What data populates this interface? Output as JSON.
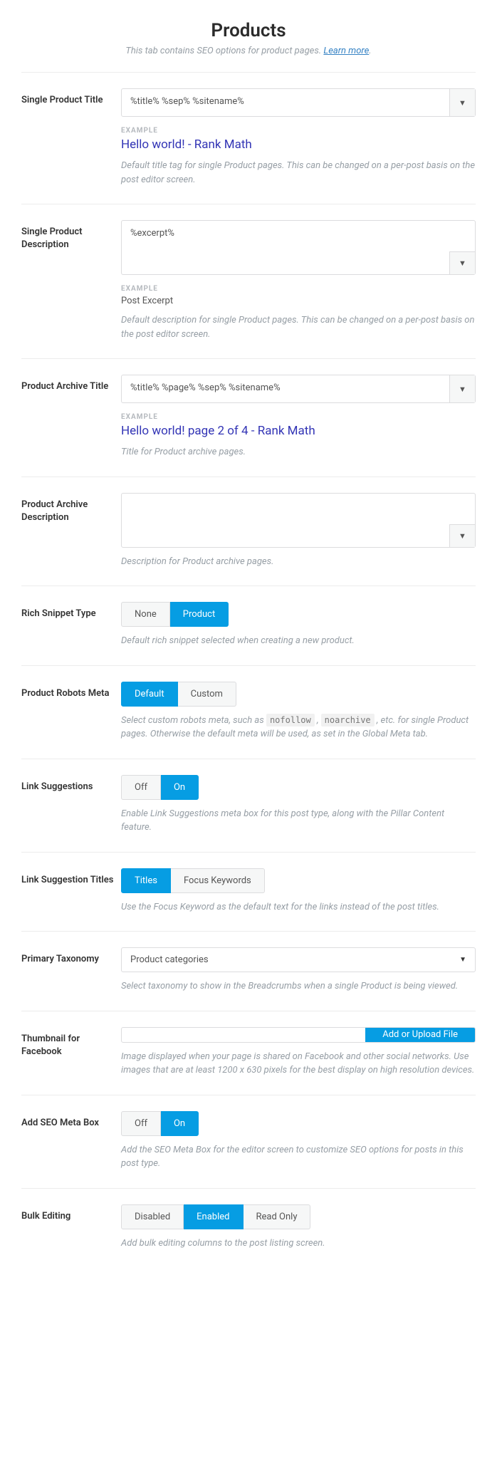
{
  "page": {
    "title": "Products",
    "subtitle_pre": "This tab contains SEO options for product pages. ",
    "learn_more": "Learn more",
    "subtitle_post": "."
  },
  "labels": {
    "example": "EXAMPLE"
  },
  "single_title": {
    "label": "Single Product Title",
    "value": "%title% %sep% %sitename%",
    "example": "Hello world! - Rank Math",
    "desc": "Default title tag for single Product pages. This can be changed on a per-post basis on the post editor screen."
  },
  "single_desc": {
    "label": "Single Product Description",
    "value": "%excerpt%",
    "example": "Post Excerpt",
    "desc": "Default description for single Product pages. This can be changed on a per-post basis on the post editor screen."
  },
  "archive_title": {
    "label": "Product Archive Title",
    "value": "%title% %page% %sep% %sitename%",
    "example": "Hello world! page 2 of 4 - Rank Math",
    "desc": "Title for Product archive pages."
  },
  "archive_desc": {
    "label": "Product Archive Description",
    "value": "",
    "desc": "Description for Product archive pages."
  },
  "rich_snippet": {
    "label": "Rich Snippet Type",
    "opt_none": "None",
    "opt_product": "Product",
    "desc": "Default rich snippet selected when creating a new product."
  },
  "robots": {
    "label": "Product Robots Meta",
    "opt_default": "Default",
    "opt_custom": "Custom",
    "desc_pre": "Select custom robots meta, such as ",
    "code1": "nofollow",
    "desc_mid1": " , ",
    "code2": "noarchive",
    "desc_mid2": " , etc. for single Product pages. Otherwise the default meta will be used, as set in the Global Meta tab."
  },
  "link_sugg": {
    "label": "Link Suggestions",
    "opt_off": "Off",
    "opt_on": "On",
    "desc": "Enable Link Suggestions meta box for this post type, along with the Pillar Content feature."
  },
  "link_sugg_titles": {
    "label": "Link Suggestion Titles",
    "opt_titles": "Titles",
    "opt_focus": "Focus Keywords",
    "desc": "Use the Focus Keyword as the default text for the links instead of the post titles."
  },
  "primary_tax": {
    "label": "Primary Taxonomy",
    "value": "Product categories",
    "desc": "Select taxonomy to show in the Breadcrumbs when a single Product is being viewed."
  },
  "thumb_fb": {
    "label": "Thumbnail for Facebook",
    "btn": "Add or Upload File",
    "desc": "Image displayed when your page is shared on Facebook and other social networks. Use images that are at least 1200 x 630 pixels for the best display on high resolution devices."
  },
  "seo_box": {
    "label": "Add SEO Meta Box",
    "opt_off": "Off",
    "opt_on": "On",
    "desc": "Add the SEO Meta Box for the editor screen to customize SEO options for posts in this post type."
  },
  "bulk_edit": {
    "label": "Bulk Editing",
    "opt_disabled": "Disabled",
    "opt_enabled": "Enabled",
    "opt_readonly": "Read Only",
    "desc": "Add bulk editing columns to the post listing screen."
  }
}
